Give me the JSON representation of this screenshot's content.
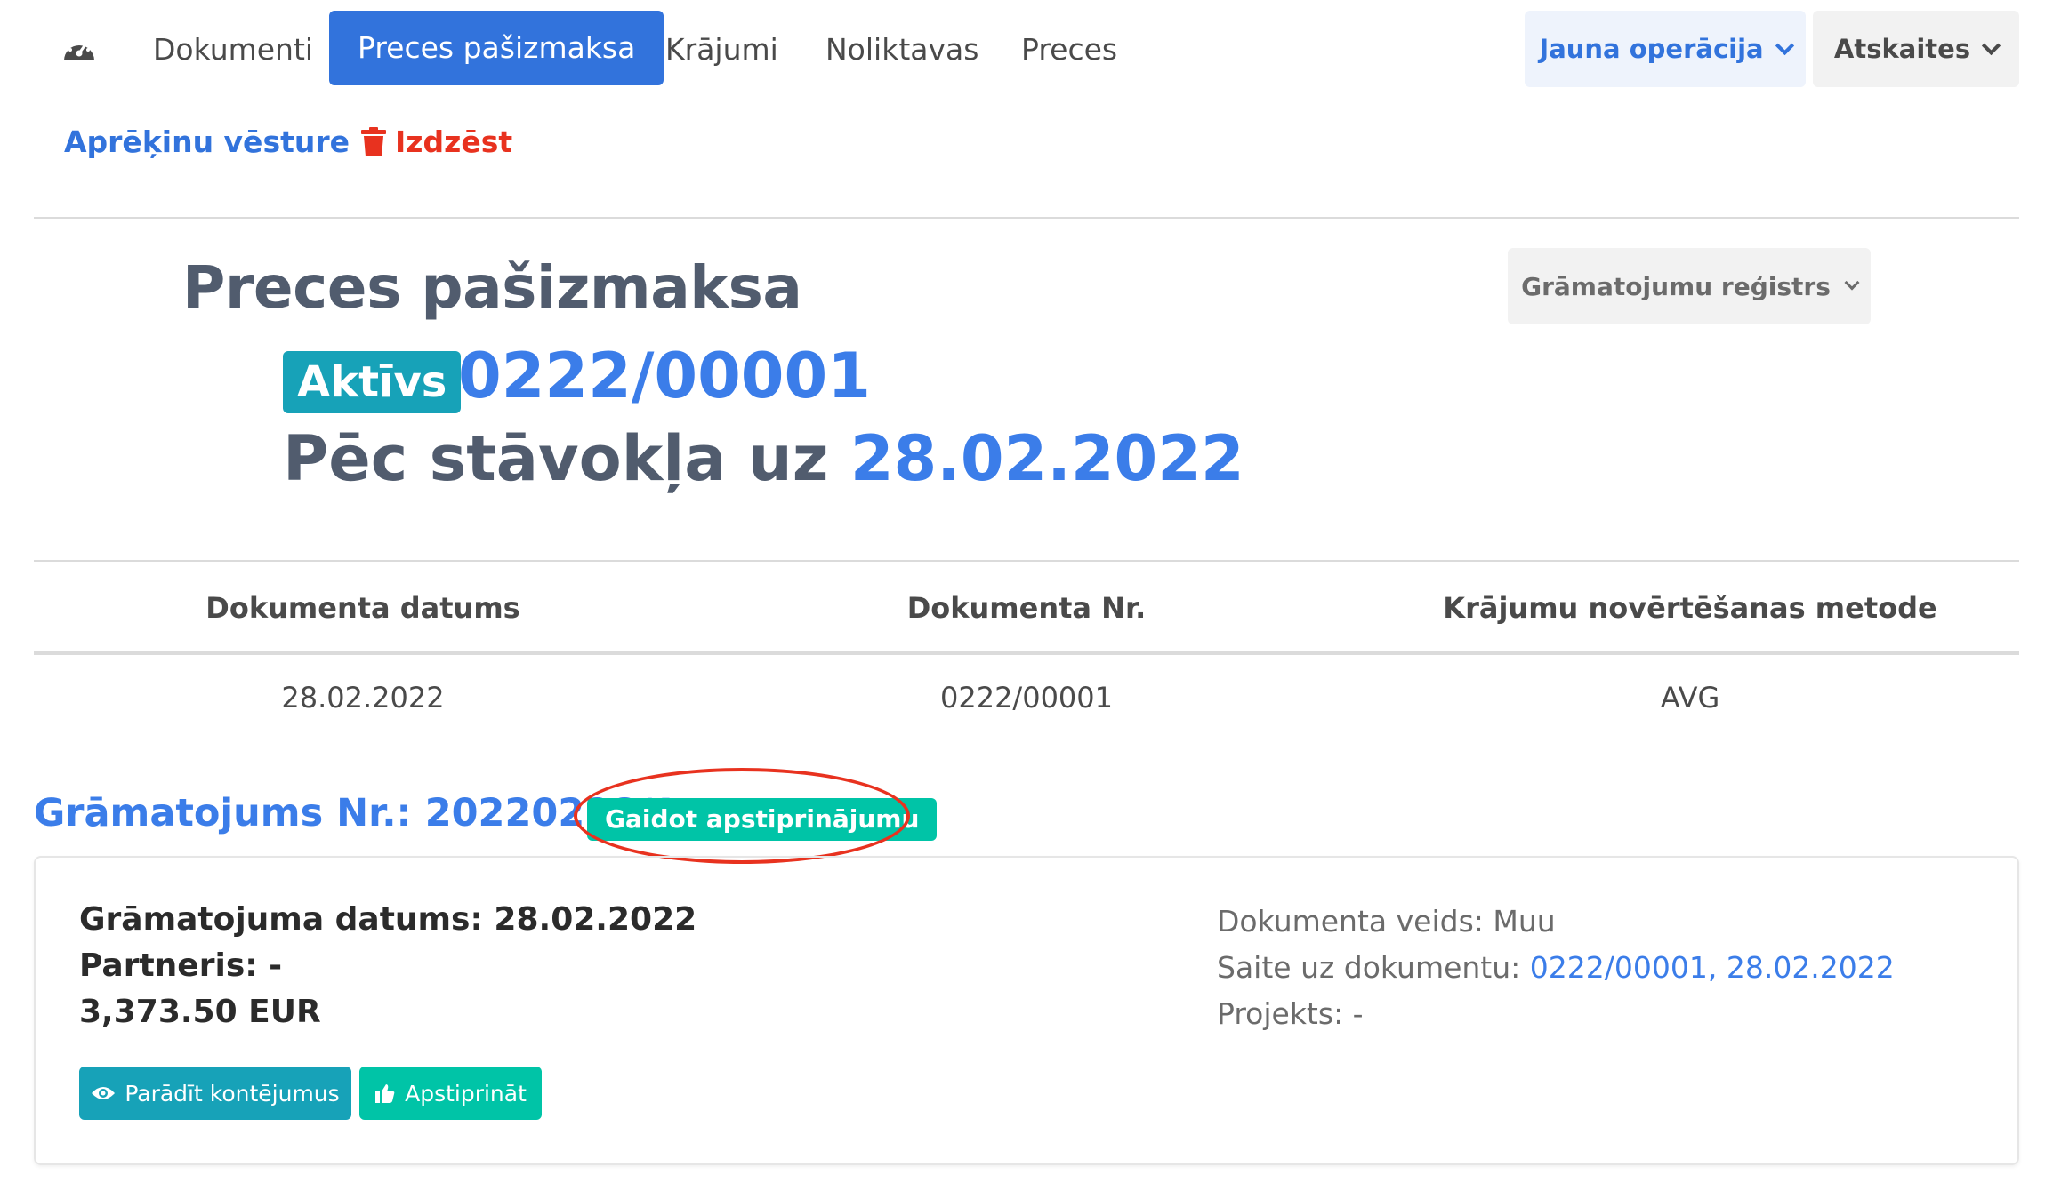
{
  "nav": {
    "items": [
      "Dokumenti",
      "Preces pašizmaksa",
      "Krājumi",
      "Noliktavas",
      "Preces"
    ],
    "new_operation": "Jauna operācija",
    "reports": "Atskaites"
  },
  "actions": {
    "history": "Aprēķinu vēsture",
    "delete": "Izdzēst"
  },
  "header": {
    "title": "Preces pašizmaksa",
    "status": "Aktīvs",
    "doc_number": "0222/00001",
    "as_of_label": "Pēc stāvokļa uz",
    "as_of_date": "28.02.2022",
    "register_button": "Grāmatojumu reģistrs"
  },
  "table": {
    "headers": [
      "Dokumenta datums",
      "Dokumenta Nr.",
      "Krājumu novērtēšanas metode"
    ],
    "row": [
      "28.02.2022",
      "0222/00001",
      "AVG"
    ]
  },
  "posting": {
    "title": "Grāmatojums Nr.: 20220228/1",
    "badge": "Gaidot apstiprinājumu",
    "date_line": "Grāmatojuma datums: 28.02.2022",
    "partner_line": "Partneris: -",
    "amount_line": "3,373.50 EUR",
    "doc_type_line": "Dokumenta veids: Muu",
    "doc_link_label": "Saite uz dokumentu:",
    "doc_link": "0222/00001, 28.02.2022",
    "project_line": "Projekts: -",
    "show_entries_button": "Parādīt kontējumus",
    "approve_button": "Apstiprināt"
  },
  "colors": {
    "primary": "#3273dc",
    "info": "#17a2b8",
    "success": "#00c4a7",
    "danger": "#e8321f",
    "highlight_ring": "#e8321f"
  }
}
